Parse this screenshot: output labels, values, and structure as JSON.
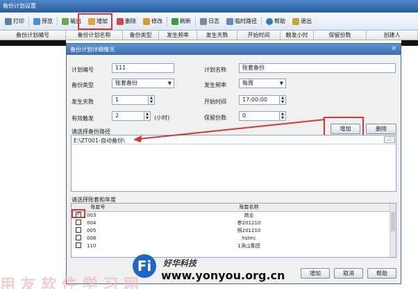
{
  "window": {
    "title": "备份计划设置"
  },
  "toolbar": {
    "items": [
      {
        "label": "打印",
        "icon": "printer-icon",
        "color": "#5d7fae"
      },
      {
        "label": "预览",
        "icon": "preview-icon",
        "color": "#4a8fd4"
      },
      {
        "label": "输出",
        "icon": "export-icon",
        "color": "#6aa84f"
      },
      {
        "label": "增加",
        "icon": "add-icon",
        "color": "#e3a33b"
      },
      {
        "label": "删除",
        "icon": "delete-icon",
        "color": "#c94c4c"
      },
      {
        "label": "修改",
        "icon": "edit-icon",
        "color": "#d49b2f"
      },
      {
        "label": "刷新",
        "icon": "refresh-icon",
        "color": "#3c9d3c"
      },
      {
        "label": "日志",
        "icon": "log-icon",
        "color": "#7a8aa0"
      },
      {
        "label": "临时路径",
        "icon": "path-icon",
        "color": "#6b87b5"
      },
      {
        "label": "帮助",
        "icon": "help-icon",
        "color": "#3b78c2"
      },
      {
        "label": "退出",
        "icon": "exit-icon",
        "color": "#c7a43a"
      }
    ]
  },
  "grid": {
    "headers": [
      "备份计划编号",
      "备份计划名称",
      "备份类型",
      "发生频率",
      "发生天数",
      "开始时间",
      "触发小时",
      "保留份数",
      "创建人"
    ]
  },
  "dialog": {
    "title": "备份计划详细情况",
    "close": "×",
    "fields": {
      "plan_no_label": "计划编号",
      "plan_no": "111",
      "plan_name_label": "计划名称",
      "plan_name": "账套备份",
      "backup_type_label": "备份类型",
      "backup_type": "账套备份",
      "frequency_label": "发生频率",
      "frequency": "每周",
      "days_label": "发生天数",
      "days": "1",
      "start_time_label": "开始时间",
      "start_time": "17:00:00",
      "trigger_label": "有效触发",
      "trigger": "2",
      "trigger_unit": "(小时)",
      "keep_label": "保留份数",
      "keep": "0"
    },
    "path_section": {
      "label": "请选择备份路径",
      "add_button": "增加",
      "delete_button": "删除",
      "path": "E:\\ZT001-自动备份\\",
      "browse": "..."
    },
    "account_section": {
      "label": "请选择账套和年度",
      "col_no": "账套号",
      "col_name": "账套名称",
      "rows": [
        {
          "no": "003",
          "name": "商业",
          "checked": true
        },
        {
          "no": "004",
          "name": "参201210",
          "checked": false
        },
        {
          "no": "005",
          "name": "照201210",
          "checked": false
        },
        {
          "no": "008",
          "name": "hslmc",
          "checked": false
        },
        {
          "no": "110",
          "name": "1涣山集团",
          "checked": false
        }
      ]
    },
    "buttons": {
      "add": "增加",
      "cancel": "取消",
      "help": "帮助"
    }
  },
  "watermark": {
    "logo_letter": "Fi",
    "brand": "好华科技",
    "url": "www.yonyou.org.cn",
    "bg_text": "用 友 软 件 学 习 网"
  },
  "colors": {
    "highlight": "#dd3333",
    "title_blue": "#3a6eb0"
  }
}
